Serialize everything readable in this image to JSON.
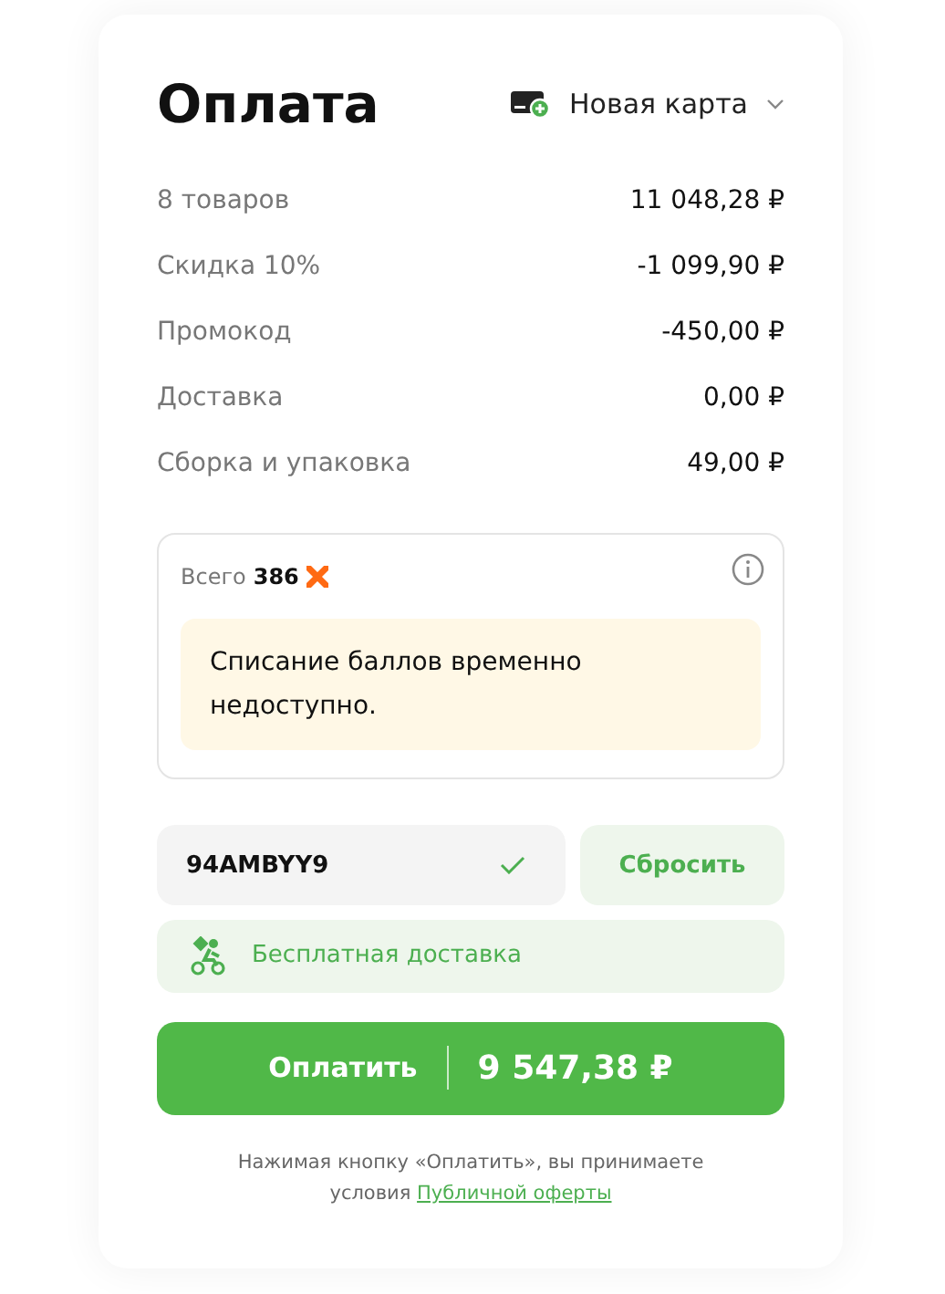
{
  "title": "Оплата",
  "payment_method": {
    "label": "Новая карта"
  },
  "summary": [
    {
      "label": "8 товаров",
      "value": "11 048,28 ₽"
    },
    {
      "label": "Скидка 10%",
      "value": "-1 099,90 ₽"
    },
    {
      "label": "Промокод",
      "value": "-450,00 ₽"
    },
    {
      "label": "Доставка",
      "value": "0,00 ₽"
    },
    {
      "label": "Сборка и упаковка",
      "value": "49,00 ₽"
    }
  ],
  "points": {
    "label": "Всего",
    "amount": "386",
    "notice": "Списание баллов временно недоступно."
  },
  "promo": {
    "value": "94AMBYY9",
    "valid": true,
    "reset": "Сбросить"
  },
  "free_delivery": "Бесплатная доставка",
  "pay_button": {
    "label": "Оплатить",
    "amount": "9 547,38 ₽"
  },
  "terms": {
    "text": "Нажимая кнопку «Оплатить», вы принимаете условия ",
    "link": "Публичной оферты"
  }
}
